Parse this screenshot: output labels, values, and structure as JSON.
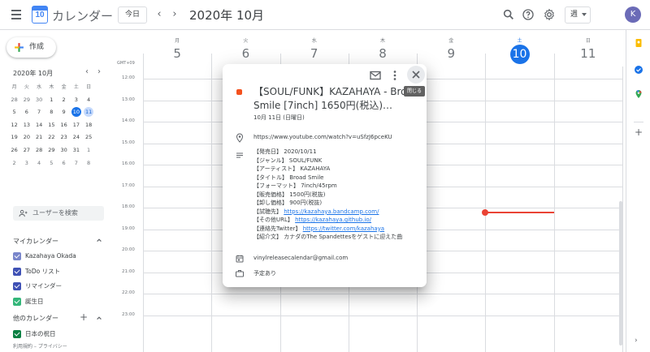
{
  "app": {
    "logo_day": "10",
    "title": "カレンダー",
    "today_label": "今日",
    "prev_arrow": "‹",
    "next_arrow": "›",
    "period": "2020年 10月",
    "view_label": "週",
    "avatar_letter": "K"
  },
  "sidebar": {
    "create_label": "作成",
    "mini_title": "2020年 10月",
    "mini_prev": "‹",
    "mini_next": "›",
    "mini_dow": [
      "月",
      "火",
      "水",
      "木",
      "金",
      "土",
      "日"
    ],
    "mini_rows": [
      [
        "28",
        "29",
        "30",
        "1",
        "2",
        "3",
        "4"
      ],
      [
        "5",
        "6",
        "7",
        "8",
        "9",
        "10",
        "11"
      ],
      [
        "12",
        "13",
        "14",
        "15",
        "16",
        "17",
        "18"
      ],
      [
        "19",
        "20",
        "21",
        "22",
        "23",
        "24",
        "25"
      ],
      [
        "26",
        "27",
        "28",
        "29",
        "30",
        "31",
        "1"
      ],
      [
        "2",
        "3",
        "4",
        "5",
        "6",
        "7",
        "8"
      ]
    ],
    "search_people": "ユーザーを検索",
    "my_calendars_label": "マイカレンダー",
    "my_calendars": [
      {
        "name": "Kazahaya Okada",
        "color": "#7986cb"
      },
      {
        "name": "ToDo リスト",
        "color": "#3f51b5"
      },
      {
        "name": "リマインダー",
        "color": "#3f51b5"
      },
      {
        "name": "誕生日",
        "color": "#33b679"
      }
    ],
    "other_calendars_label": "他のカレンダー",
    "other_calendars": [
      {
        "name": "日本の祝日",
        "color": "#0b8043"
      }
    ],
    "footer": "利用規約 – プライバシー"
  },
  "week": {
    "timezone": "GMT+09",
    "days": [
      {
        "dow": "月",
        "num": "5"
      },
      {
        "dow": "火",
        "num": "6"
      },
      {
        "dow": "水",
        "num": "7"
      },
      {
        "dow": "木",
        "num": "8"
      },
      {
        "dow": "金",
        "num": "9"
      },
      {
        "dow": "土",
        "num": "10"
      },
      {
        "dow": "日",
        "num": "11"
      }
    ],
    "hours": [
      "12:00",
      "13:00",
      "14:00",
      "15:00",
      "16:00",
      "17:00",
      "18:00",
      "19:00",
      "20:00",
      "21:00",
      "22:00",
      "23:00"
    ]
  },
  "popup": {
    "close_tooltip": "閉じる",
    "title_line1": "【SOUL/FUNK】KAZAHAYA - Broad",
    "title_line2": "Smile [7inch] 1650円(税込)…",
    "date": "10月 11日 (日曜日)",
    "location": "https://www.youtube.com/watch?v=uSfzJ6pceKU",
    "description": [
      {
        "label": "【発売日】 2020/10/11"
      },
      {
        "label": "【ジャンル】 SOUL/FUNK"
      },
      {
        "label": "【アーティスト】 KAZAHAYA"
      },
      {
        "label": "【タイトル】 Broad Smile"
      },
      {
        "label": "【フォーマット】 7inch/45rpm"
      },
      {
        "label": "【販売価格】 1500円(税抜)"
      },
      {
        "label": "【卸し価格】 900円(税抜)"
      },
      {
        "label": "【試聴先】 ",
        "link": "https://kazahaya.bandcamp.com/"
      },
      {
        "label": "【その他URL】 ",
        "link": "https://kazahaya.github.io/"
      },
      {
        "label": "【連絡先Twitter】 ",
        "link": "https://twitter.com/kazahaya"
      },
      {
        "label": "【紹介文】 カナダのThe Spandettesをゲストに迎えた曲"
      }
    ],
    "calendar": "vinylreleasecalendar@gmail.com",
    "status": "予定あり",
    "color": "#f4511e"
  }
}
